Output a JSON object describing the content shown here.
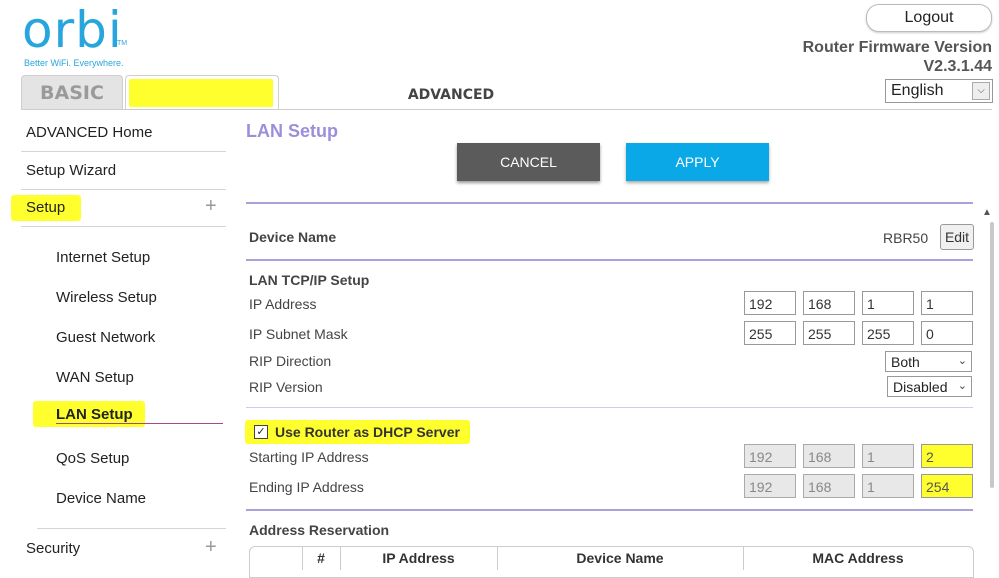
{
  "logo": {
    "word": "orbi",
    "tm": "TM",
    "tagline": "Better WiFi. Everywhere."
  },
  "tabs": {
    "basic": "BASIC",
    "advanced": "ADVANCED"
  },
  "header": {
    "logout": "Logout",
    "firmware_label": "Router Firmware Version",
    "firmware_version": "V2.3.1.44",
    "language": "English"
  },
  "sidebar": {
    "items": [
      {
        "label": "ADVANCED Home"
      },
      {
        "label": "Setup Wizard"
      },
      {
        "label": "Setup",
        "expand": "+"
      },
      {
        "label": "Security",
        "expand": "+"
      }
    ],
    "sub_items": [
      {
        "label": "Internet Setup"
      },
      {
        "label": "Wireless Setup"
      },
      {
        "label": "Guest Network"
      },
      {
        "label": "WAN Setup"
      },
      {
        "label": "LAN Setup",
        "active": true
      },
      {
        "label": "QoS Setup"
      },
      {
        "label": "Device Name"
      }
    ]
  },
  "main": {
    "title": "LAN Setup",
    "cancel": "CANCEL",
    "apply": "APPLY",
    "device_name_label": "Device Name",
    "device_name_value": "RBR50",
    "edit": "Edit",
    "lan_tcpip_heading": "LAN TCP/IP Setup",
    "ip_address_label": "IP Address",
    "ip_address": [
      "192",
      "168",
      "1",
      "1"
    ],
    "subnet_label": "IP Subnet Mask",
    "subnet": [
      "255",
      "255",
      "255",
      "0"
    ],
    "rip_direction_label": "RIP Direction",
    "rip_direction": "Both",
    "rip_version_label": "RIP Version",
    "rip_version": "Disabled",
    "dhcp_label": "Use Router as DHCP Server",
    "dhcp_checked": "✓",
    "start_ip_label": "Starting IP Address",
    "start_ip": [
      "192",
      "168",
      "1",
      "2"
    ],
    "end_ip_label": "Ending IP Address",
    "end_ip": [
      "192",
      "168",
      "1",
      "254"
    ],
    "reservation_heading": "Address Reservation",
    "table_headers": [
      "#",
      "IP Address",
      "Device Name",
      "MAC Address"
    ]
  },
  "colors": {
    "accent_blue": "#0aa8e6",
    "title_purple": "#9b8fdc",
    "highlight_yellow": "#ffff2e",
    "logo_blue": "#27a5dd"
  }
}
